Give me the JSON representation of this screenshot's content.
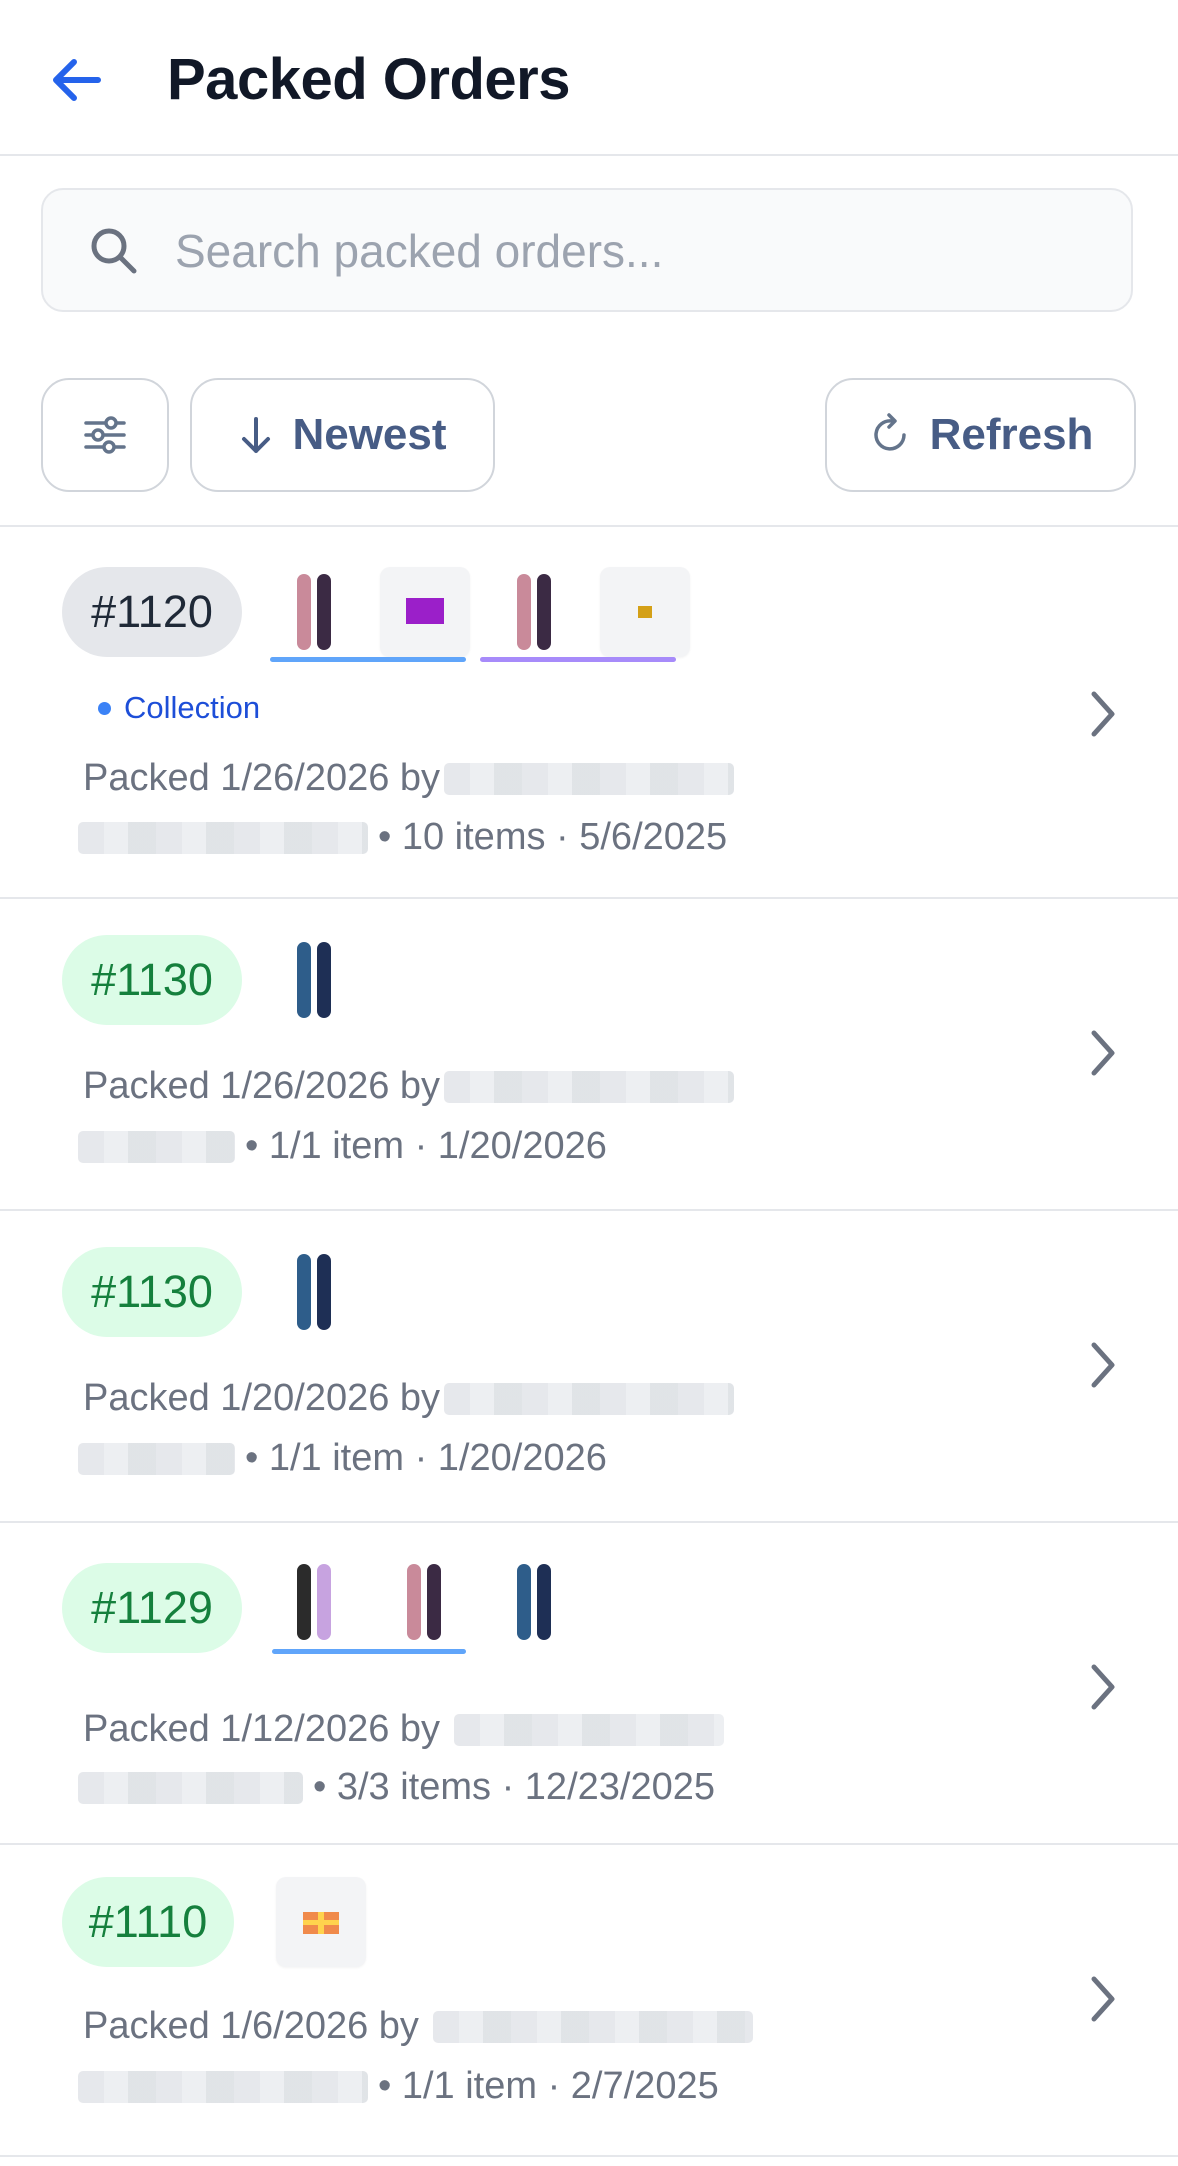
{
  "header": {
    "title": "Packed Orders",
    "back_icon": "arrow-left-icon"
  },
  "search": {
    "placeholder": "Search packed orders...",
    "value": ""
  },
  "toolbar": {
    "sort_label": "Newest",
    "refresh_label": "Refresh"
  },
  "colors": {
    "accent": "#2563eb",
    "green_pill_bg": "#dcfce7",
    "green_pill_text": "#15803d",
    "gray_pill_bg": "#e5e7eb"
  },
  "orders": [
    {
      "number": "#1120",
      "status": "gray",
      "tag": "Collection",
      "packed": "Packed 1/26/2026 by",
      "meta": "• 10 items · 5/6/2025"
    },
    {
      "number": "#1130",
      "status": "green",
      "packed": "Packed 1/26/2026 by",
      "meta": "• 1/1 item · 1/20/2026"
    },
    {
      "number": "#1130",
      "status": "green",
      "packed": "Packed 1/20/2026 by",
      "meta": "• 1/1 item · 1/20/2026"
    },
    {
      "number": "#1129",
      "status": "green",
      "packed": "Packed 1/12/2026 by",
      "meta": "• 3/3 items · 12/23/2025"
    },
    {
      "number": "#1110",
      "status": "green",
      "packed": "Packed 1/6/2026 by",
      "meta": "• 1/1 item · 2/7/2025"
    }
  ]
}
